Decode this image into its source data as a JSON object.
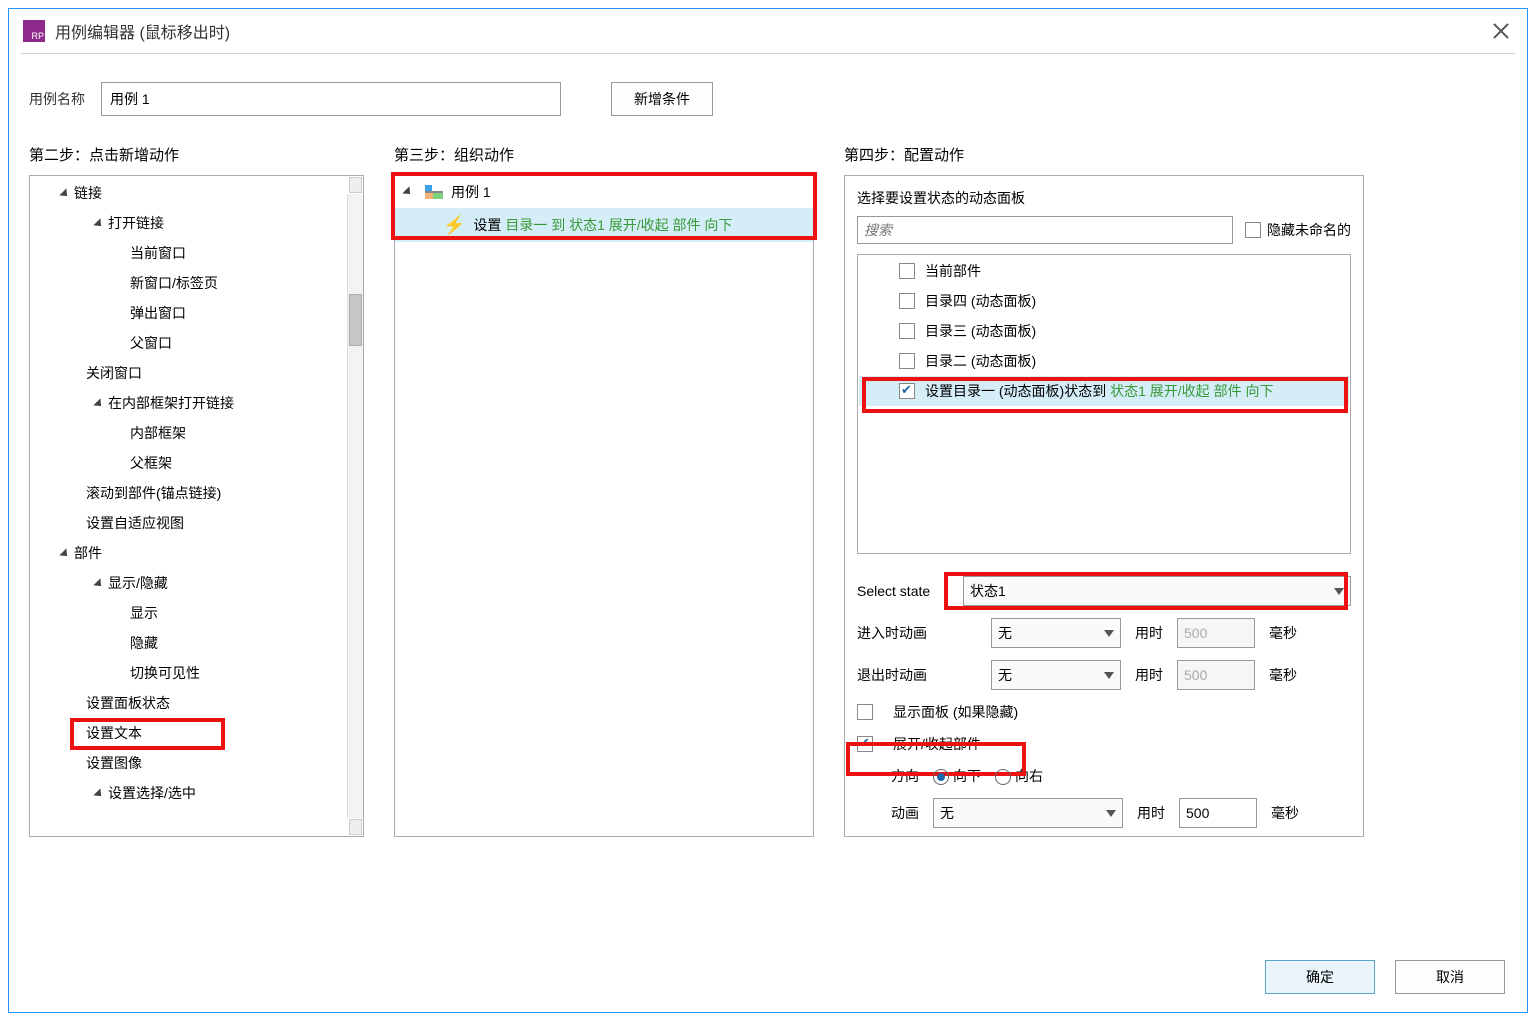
{
  "title": "用例编辑器 (鼠标移出时)",
  "row1": {
    "label": "用例名称",
    "value": "用例 1",
    "add_cond": "新增条件"
  },
  "col_heads": {
    "c1": "第二步：点击新增动作",
    "c2": "第三步：组织动作",
    "c3": "第四步：配置动作"
  },
  "tree": {
    "links": "链接",
    "open_link": "打开链接",
    "cur_win": "当前窗口",
    "new_tab": "新窗口/标签页",
    "popup": "弹出窗口",
    "parent_win": "父窗口",
    "close_win": "关闭窗口",
    "in_iframe": "在内部框架打开链接",
    "inner_frame": "内部框架",
    "parent_frame": "父框架",
    "scroll_anchor": "滚动到部件(锚点链接)",
    "set_adaptive": "设置自适应视图",
    "widgets": "部件",
    "show_hide": "显示/隐藏",
    "show": "显示",
    "hide": "隐藏",
    "toggle_vis": "切换可见性",
    "set_panel_state": "设置面板状态",
    "set_text": "设置文本",
    "set_image": "设置图像",
    "set_select": "设置选择/选中"
  },
  "case": {
    "name": "用例 1",
    "action_prefix": "设置 ",
    "action_green": "目录一 到 状态1 展开/收起 部件 向下"
  },
  "cfg": {
    "head": "选择要设置状态的动态面板",
    "search_ph": "搜索",
    "hide_unnamed": "隐藏未命名的",
    "items": {
      "current": "当前部件",
      "d4": "目录四 (动态面板)",
      "d3": "目录三 (动态面板)",
      "d2": "目录二 (动态面板)",
      "sel_prefix": "设置目录一 (动态面板)状态到 ",
      "sel_green": "状态1 展开/收起 部件 向下"
    },
    "select_state_label": "Select state",
    "select_state_value": "状态1",
    "anim_in": "进入时动画",
    "anim_out": "退出时动画",
    "none": "无",
    "dur_label": "用时",
    "ms": "毫秒",
    "dur_val": "500",
    "show_if_hidden": "显示面板 (如果隐藏)",
    "push_pull": "展开/收起部件",
    "dir_label": "方向",
    "dir_down": "向下",
    "dir_right": "向右",
    "anim_label": "动画"
  },
  "footer": {
    "ok": "确定",
    "cancel": "取消"
  }
}
